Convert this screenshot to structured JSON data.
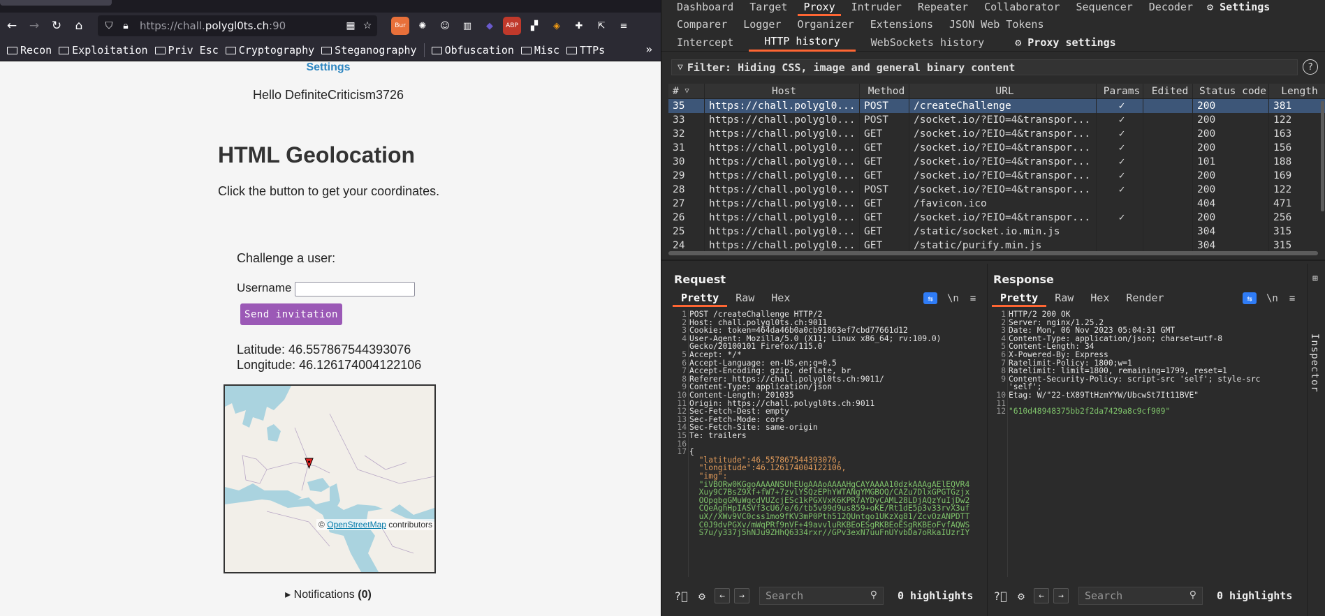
{
  "browser": {
    "url_prefix": "https://chall.",
    "url_host": "polygl0ts.ch",
    "url_rest": ":90",
    "bookmarks": [
      "Recon",
      "Exploitation",
      "Priv Esc",
      "Cryptography",
      "Steganography",
      "Obfuscation",
      "Misc",
      "TTPs"
    ],
    "extension_badge": "Bur"
  },
  "page": {
    "settings_link": "Settings",
    "greeting": "Hello DefiniteCriticism3726",
    "heading": "HTML Geolocation",
    "hint": "Click the button to get your coordinates.",
    "challenge_label": "Challenge a user:",
    "username_label": "Username",
    "username_value": "",
    "send_button": "Send invitation",
    "latitude": "Latitude: 46.557867544393076",
    "longitude": "Longitude: 46.126174004122106",
    "map_attribution_prefix": "©",
    "map_attribution_link": "OpenStreetMap",
    "map_attribution_suffix": "contributors",
    "notifications_label": "▸ Notifications",
    "notifications_count": "(0)"
  },
  "burp": {
    "top_tabs_row1": [
      "Dashboard",
      "Target",
      "Proxy",
      "Intruder",
      "Repeater",
      "Collaborator",
      "Sequencer",
      "Decoder"
    ],
    "active_tab": "Proxy",
    "settings_label": "Settings",
    "top_tabs_row2": [
      "Comparer",
      "Logger",
      "Organizer",
      "Extensions",
      "JSON Web Tokens"
    ],
    "sub_tabs": [
      "Intercept",
      "HTTP history",
      "WebSockets history"
    ],
    "active_sub_tab": "HTTP history",
    "proxy_settings": "Proxy settings",
    "filter": "Filter: Hiding CSS, image and general binary content",
    "columns": [
      "#",
      "Host",
      "Method",
      "URL",
      "Params",
      "Edited",
      "Status code",
      "Length"
    ],
    "rows": [
      {
        "num": "35",
        "host": "https://chall.polygl0...",
        "method": "POST",
        "url": "/createChallenge",
        "params": "✓",
        "status": "200",
        "length": "381"
      },
      {
        "num": "33",
        "host": "https://chall.polygl0...",
        "method": "POST",
        "url": "/socket.io/?EIO=4&transpor...",
        "params": "✓",
        "status": "200",
        "length": "122"
      },
      {
        "num": "32",
        "host": "https://chall.polygl0...",
        "method": "GET",
        "url": "/socket.io/?EIO=4&transpor...",
        "params": "✓",
        "status": "200",
        "length": "163"
      },
      {
        "num": "31",
        "host": "https://chall.polygl0...",
        "method": "GET",
        "url": "/socket.io/?EIO=4&transpor...",
        "params": "✓",
        "status": "200",
        "length": "156"
      },
      {
        "num": "30",
        "host": "https://chall.polygl0...",
        "method": "GET",
        "url": "/socket.io/?EIO=4&transpor...",
        "params": "✓",
        "status": "101",
        "length": "188"
      },
      {
        "num": "29",
        "host": "https://chall.polygl0...",
        "method": "GET",
        "url": "/socket.io/?EIO=4&transpor...",
        "params": "✓",
        "status": "200",
        "length": "169"
      },
      {
        "num": "28",
        "host": "https://chall.polygl0...",
        "method": "POST",
        "url": "/socket.io/?EIO=4&transpor...",
        "params": "✓",
        "status": "200",
        "length": "122"
      },
      {
        "num": "27",
        "host": "https://chall.polygl0...",
        "method": "GET",
        "url": "/favicon.ico",
        "params": "",
        "status": "404",
        "length": "471"
      },
      {
        "num": "26",
        "host": "https://chall.polygl0...",
        "method": "GET",
        "url": "/socket.io/?EIO=4&transpor...",
        "params": "✓",
        "status": "200",
        "length": "256"
      },
      {
        "num": "25",
        "host": "https://chall.polygl0...",
        "method": "GET",
        "url": "/static/socket.io.min.js",
        "params": "",
        "status": "304",
        "length": "315"
      },
      {
        "num": "24",
        "host": "https://chall.polygl0...",
        "method": "GET",
        "url": "/static/purify.min.js",
        "params": "",
        "status": "304",
        "length": "315"
      }
    ],
    "request": {
      "title": "Request",
      "tabs": [
        "Pretty",
        "Raw",
        "Hex"
      ],
      "lines": [
        "POST /createChallenge HTTP/2",
        "Host: chall.polygl0ts.ch:9011",
        "Cookie: token=464da46b0a0cb91863ef7cbd77661d12",
        "User-Agent: Mozilla/5.0 (X11; Linux x86_64; rv:109.0)",
        "Gecko/20100101 Firefox/115.0",
        "Accept: */*",
        "Accept-Language: en-US,en;q=0.5",
        "Accept-Encoding: gzip, deflate, br",
        "Referer: https://chall.polygl0ts.ch:9011/",
        "Content-Type: application/json",
        "Content-Length: 201035",
        "Origin: https://chall.polygl0ts.ch:9011",
        "Sec-Fetch-Dest: empty",
        "Sec-Fetch-Mode: cors",
        "Sec-Fetch-Site: same-origin",
        "Te: trailers",
        "",
        "{",
        "  \"latitude\":46.557867544393076,",
        "  \"longitude\":46.126174004122106,",
        "  \"img\":",
        "  \"iVBORw0KGgoAAAANSUhEUgAAAoAAAAHgCAYAAAA10dzkAAAgAElEQVR4",
        "  Xuy9C7BsZ9Xf+fW7+7zvlYSQzEPhYWTANgYMGBOQ/CAZu7DlxGPGTGzjx",
        "  OOpqbgGMuWqcdVUZcjESc1kPGXVxK6KPR7AYDyCAML28LDjAQzYuIjDw2",
        "  CQeAghHpIASVf3cU6/e/6/tb5v99d9us859+oKE/Rt1dE5p3v33rvX3uf",
        "  uX//XWv9VC0css1mo9fKV3mP0Pth512QUntqo1UKzXg81/ZcvOzANPDTT",
        "  C0J9dvPGXv/mWqPRf9nVF+49avvluRKBEoESgRKBEoESgRKBEoFvfAQWS",
        "  S7u/y337j5hNJu9ZHhQ6334rxr//GPv3exN7uuFnUYvbDa7oRkaIUzrIY"
      ],
      "line_numbers": [
        "1",
        "2",
        "3",
        "4",
        "",
        "5",
        "6",
        "7",
        "8",
        "9",
        "10",
        "11",
        "12",
        "13",
        "14",
        "15",
        "16",
        "17",
        "",
        "",
        "",
        "",
        "",
        "",
        "",
        "",
        "",
        ""
      ]
    },
    "response": {
      "title": "Response",
      "tabs": [
        "Pretty",
        "Raw",
        "Hex",
        "Render"
      ],
      "lines": [
        "HTTP/2 200 OK",
        "Server: nginx/1.25.2",
        "Date: Mon, 06 Nov 2023 05:04:31 GMT",
        "Content-Type: application/json; charset=utf-8",
        "Content-Length: 34",
        "X-Powered-By: Express",
        "Ratelimit-Policy: 1800;w=1",
        "Ratelimit: limit=1800, remaining=1799, reset=1",
        "Content-Security-Policy: script-src 'self'; style-src",
        "'self';",
        "Etag: W/\"22-tX89TtHzmYYW/UbcwSt7It11BVE\"",
        "",
        "\"610d48948375bb2f2da7429a8c9cf909\""
      ],
      "line_numbers": [
        "1",
        "2",
        "3",
        "4",
        "5",
        "6",
        "7",
        "8",
        "9",
        "",
        "10",
        "11",
        "12"
      ]
    },
    "search_placeholder": "Search",
    "highlights": "0 highlights",
    "inspector_label": "Inspector"
  }
}
